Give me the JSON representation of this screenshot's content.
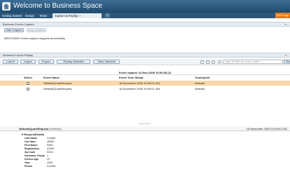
{
  "app": {
    "title": "Welcome to Business Space",
    "edit_page": "Edit Page"
  },
  "tabs": [
    {
      "label": "Getting Started"
    },
    {
      "label": "Design"
    },
    {
      "label": "Tester"
    },
    {
      "label": "Capture & Replay"
    }
  ],
  "capture": {
    "title": "Business Events Capture",
    "start_label": "Start Capture",
    "stop_label": "Stop Capture",
    "message": "BEEIY0350I: Event capture stopped successfully."
  },
  "replay": {
    "title": "Business Events Replay",
    "load_label": "Load",
    "import_label": "Import",
    "export_label": "Export",
    "replay_label": "Replay Selected",
    "save_label": "Save Selected",
    "search_placeholder": "Type to filter on event name",
    "go_label": "Go"
  },
  "table": {
    "caption": "Event capture 16-Nov-2009 10:00:58 (2)",
    "headers": [
      "Select",
      "Event Name",
      "Event Time Stamp",
      "Touchpoint"
    ],
    "rows": [
      {
        "name": "WebsiteQuoteRequest",
        "time": "16 November 2009 10:09:01.031",
        "touchpoint": "Website"
      },
      {
        "name": "WebsiteQuoteRequest",
        "time": "16 November 2009 10:09:01.406",
        "touchpoint": "Website"
      }
    ]
  },
  "detail": {
    "event": "WebsiteQuoteRequest",
    "source": "(Website)",
    "timestamp": "16 November 2009 10:09:01.031",
    "section": "RequestDetails",
    "properties": [
      {
        "label": "Last Name",
        "value": "Crocker"
      },
      {
        "label": "Car Value",
        "value": "40000"
      },
      {
        "label": "First Name",
        "value": "Peter"
      },
      {
        "label": "Registration",
        "value": "A1000"
      },
      {
        "label": "Zip Code",
        "value": "SO21"
      },
      {
        "label": "Insurance Group",
        "value": "1"
      },
      {
        "label": "Drivers Age",
        "value": "22"
      },
      {
        "label": "Year",
        "value": "2009"
      },
      {
        "label": "Phone",
        "value": "012345"
      }
    ]
  },
  "colors": {
    "banner": "#1f4a6c",
    "selected_row": "#fbd7a7",
    "edit_page": "#e07b1c"
  }
}
